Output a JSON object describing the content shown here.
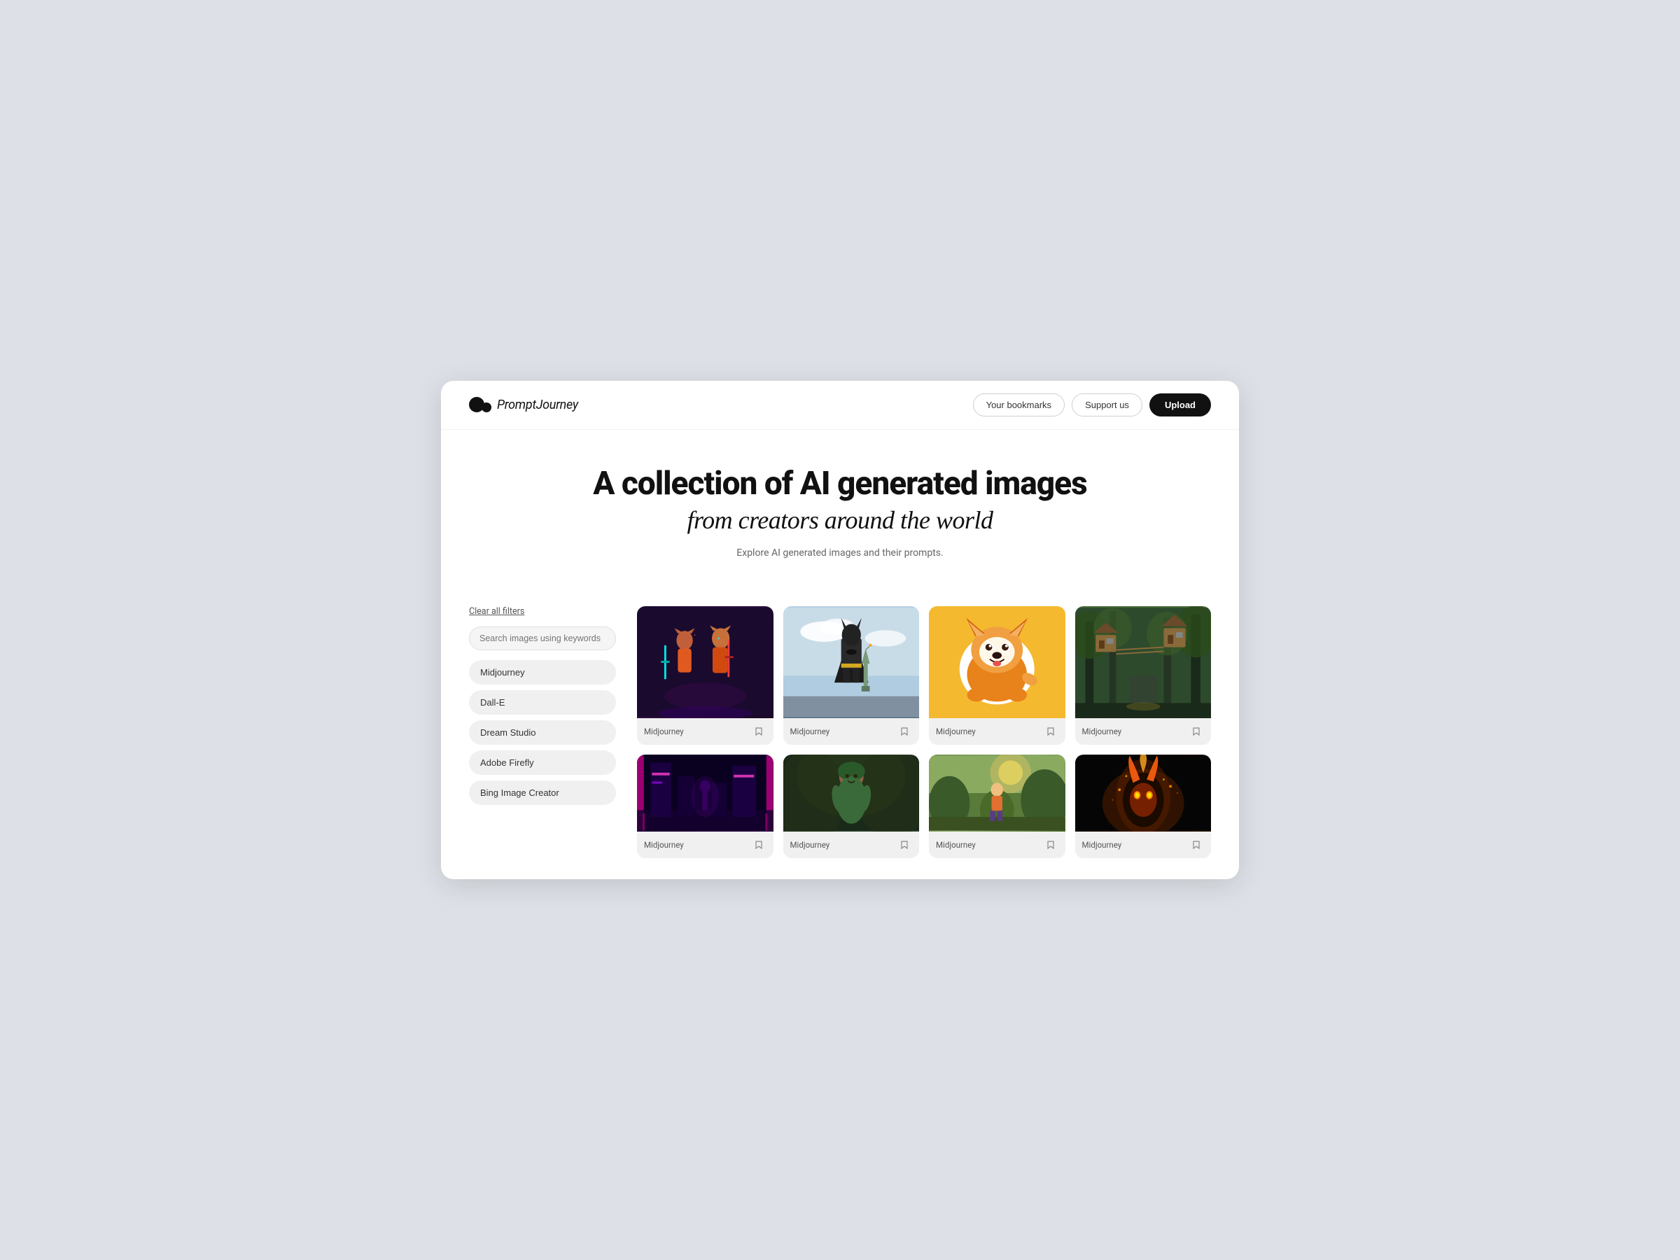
{
  "meta": {
    "bg_color": "#dde1e7"
  },
  "navbar": {
    "logo_name": "Prompt",
    "logo_suffix": "Journey",
    "bookmarks_label": "Your bookmarks",
    "support_label": "Support us",
    "upload_label": "Upload"
  },
  "hero": {
    "title": "A collection of AI generated images",
    "subtitle": "from creators around the world",
    "description": "Explore AI generated images and their prompts."
  },
  "sidebar": {
    "clear_label": "Clear all filters",
    "search_placeholder": "Search images using keywords",
    "filters": [
      {
        "id": "midjourney",
        "label": "Midjourney"
      },
      {
        "id": "dall-e",
        "label": "Dall-E"
      },
      {
        "id": "dream-studio",
        "label": "Dream Studio"
      },
      {
        "id": "adobe-firefly",
        "label": "Adobe Firefly"
      },
      {
        "id": "bing-image-creator",
        "label": "Bing Image Creator"
      }
    ]
  },
  "images": {
    "row1": [
      {
        "id": "img1",
        "label": "Midjourney",
        "style": "art-fox"
      },
      {
        "id": "img2",
        "label": "Midjourney",
        "style": "art-batman"
      },
      {
        "id": "img3",
        "label": "Midjourney",
        "style": "art-corgi"
      },
      {
        "id": "img4",
        "label": "Midjourney",
        "style": "art-treehouse"
      }
    ],
    "row2": [
      {
        "id": "img5",
        "label": "Midjourney",
        "style": "art-neon"
      },
      {
        "id": "img6",
        "label": "Midjourney",
        "style": "art-green"
      },
      {
        "id": "img7",
        "label": "Midjourney",
        "style": "art-outdoor"
      },
      {
        "id": "img8",
        "label": "Midjourney",
        "style": "art-fire"
      }
    ]
  }
}
